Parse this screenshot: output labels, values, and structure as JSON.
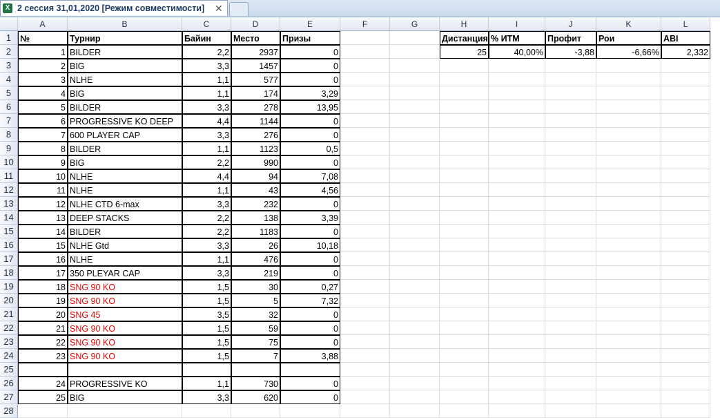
{
  "workbook": {
    "tab_title": "2 сессия 31,01,2020  [Режим совместимости]",
    "tab_close": "✕",
    "app_icon": "X"
  },
  "columns": [
    "A",
    "B",
    "C",
    "D",
    "E",
    "F",
    "G",
    "H",
    "I",
    "J",
    "K",
    "L"
  ],
  "headers": {
    "A": "№",
    "B": "Турнир",
    "C": "Байин",
    "D": "Место",
    "E": "Призы"
  },
  "rows": [
    {
      "n": "1",
      "t": "BILDER",
      "b": "2,2",
      "m": "2937",
      "p": "0",
      "red": false
    },
    {
      "n": "2",
      "t": "BIG",
      "b": "3,3",
      "m": "1457",
      "p": "0",
      "red": false
    },
    {
      "n": "3",
      "t": "NLHE",
      "b": "1,1",
      "m": "577",
      "p": "0",
      "red": false
    },
    {
      "n": "4",
      "t": "BIG",
      "b": "1,1",
      "m": "174",
      "p": "3,29",
      "red": false
    },
    {
      "n": "5",
      "t": "BILDER",
      "b": "3,3",
      "m": "278",
      "p": "13,95",
      "red": false
    },
    {
      "n": "6",
      "t": "PROGRESSIVE KO DEEP",
      "b": "4,4",
      "m": "1144",
      "p": "0",
      "red": false
    },
    {
      "n": "7",
      "t": "600 PLAYER CAP",
      "b": "3,3",
      "m": "276",
      "p": "0",
      "red": false
    },
    {
      "n": "8",
      "t": "BILDER",
      "b": "1,1",
      "m": "1123",
      "p": "0,5",
      "red": false
    },
    {
      "n": "9",
      "t": "BIG",
      "b": "2,2",
      "m": "990",
      "p": "0",
      "red": false
    },
    {
      "n": "10",
      "t": "NLHE",
      "b": "4,4",
      "m": "94",
      "p": "7,08",
      "red": false
    },
    {
      "n": "11",
      "t": "NLHE",
      "b": "1,1",
      "m": "43",
      "p": "4,56",
      "red": false
    },
    {
      "n": "12",
      "t": "NLHE CTD 6-max",
      "b": "3,3",
      "m": "232",
      "p": "0",
      "red": false
    },
    {
      "n": "13",
      "t": "DEEP STACKS",
      "b": "2,2",
      "m": "138",
      "p": "3,39",
      "red": false
    },
    {
      "n": "14",
      "t": "BILDER",
      "b": "2,2",
      "m": "1183",
      "p": "0",
      "red": false
    },
    {
      "n": "15",
      "t": "NLHE Gtd",
      "b": "3,3",
      "m": "26",
      "p": "10,18",
      "red": false
    },
    {
      "n": "16",
      "t": "NLHE",
      "b": "1,1",
      "m": "476",
      "p": "0",
      "red": false
    },
    {
      "n": "17",
      "t": "350 PLEYAR CAP",
      "b": "3,3",
      "m": "219",
      "p": "0",
      "red": false
    },
    {
      "n": "18",
      "t": "SNG 90 KO",
      "b": "1,5",
      "m": "30",
      "p": "0,27",
      "red": true
    },
    {
      "n": "19",
      "t": "SNG 90 KO",
      "b": "1,5",
      "m": "5",
      "p": "7,32",
      "red": true
    },
    {
      "n": "20",
      "t": "SNG 45",
      "b": "3,5",
      "m": "32",
      "p": "0",
      "red": true
    },
    {
      "n": "21",
      "t": "SNG 90 KO",
      "b": "1,5",
      "m": "59",
      "p": "0",
      "red": true
    },
    {
      "n": "22",
      "t": "SNG 90 KO",
      "b": "1,5",
      "m": "75",
      "p": "0",
      "red": true
    },
    {
      "n": "23",
      "t": "SNG 90 KO",
      "b": "1,5",
      "m": "7",
      "p": "3,88",
      "red": true
    },
    {
      "n": "",
      "t": "",
      "b": "",
      "m": "",
      "p": "",
      "red": false
    },
    {
      "n": "24",
      "t": "PROGRESSIVE KO",
      "b": "1,1",
      "m": "730",
      "p": "0",
      "red": false
    },
    {
      "n": "25",
      "t": "BIG",
      "b": "3,3",
      "m": "620",
      "p": "0",
      "red": false
    }
  ],
  "summary": {
    "headers": [
      "Дистанция",
      "% ИТМ",
      "Профит",
      "Рои",
      "ABI"
    ],
    "values": [
      "25",
      "40,00%",
      "-3,88",
      "-6,66%",
      "2,332"
    ]
  }
}
